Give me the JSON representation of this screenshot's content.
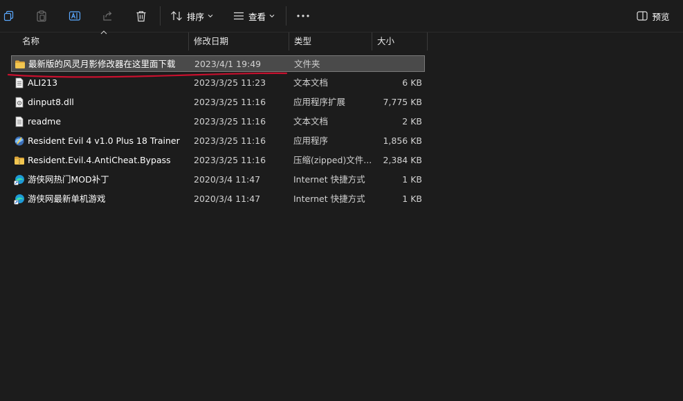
{
  "toolbar": {
    "sort_label": "排序",
    "view_label": "查看",
    "preview_label": "预览"
  },
  "columns": {
    "name": "名称",
    "date": "修改日期",
    "type": "类型",
    "size": "大小"
  },
  "files": [
    {
      "name": "最新版的风灵月影修改器在这里面下载",
      "date": "2023/4/1 19:49",
      "type": "文件夹",
      "size": "",
      "icon": "folder-icon",
      "selected": true
    },
    {
      "name": "ALI213",
      "date": "2023/3/25 11:23",
      "type": "文本文档",
      "size": "6 KB",
      "icon": "text-file-icon"
    },
    {
      "name": "dinput8.dll",
      "date": "2023/3/25 11:16",
      "type": "应用程序扩展",
      "size": "7,775 KB",
      "icon": "dll-file-icon"
    },
    {
      "name": "readme",
      "date": "2023/3/25 11:16",
      "type": "文本文档",
      "size": "2 KB",
      "icon": "text-file-icon"
    },
    {
      "name": "Resident Evil 4 v1.0 Plus 18 Trainer",
      "date": "2023/3/25 11:16",
      "type": "应用程序",
      "size": "1,856 KB",
      "icon": "application-icon"
    },
    {
      "name": "Resident.Evil.4.AntiCheat.Bypass",
      "date": "2023/3/25 11:16",
      "type": "压缩(zipped)文件...",
      "size": "2,384 KB",
      "icon": "zip-folder-icon"
    },
    {
      "name": "游侠网热门MOD补丁",
      "date": "2020/3/4 11:47",
      "type": "Internet 快捷方式",
      "size": "1 KB",
      "icon": "internet-shortcut-icon"
    },
    {
      "name": "游侠网最新单机游戏",
      "date": "2020/3/4 11:47",
      "type": "Internet 快捷方式",
      "size": "1 KB",
      "icon": "internet-shortcut-icon"
    }
  ],
  "colors": {
    "background": "#1c1c1c",
    "selection": "#4a4a4a",
    "annotation": "#c8102e",
    "folder": "#f0c14b"
  }
}
